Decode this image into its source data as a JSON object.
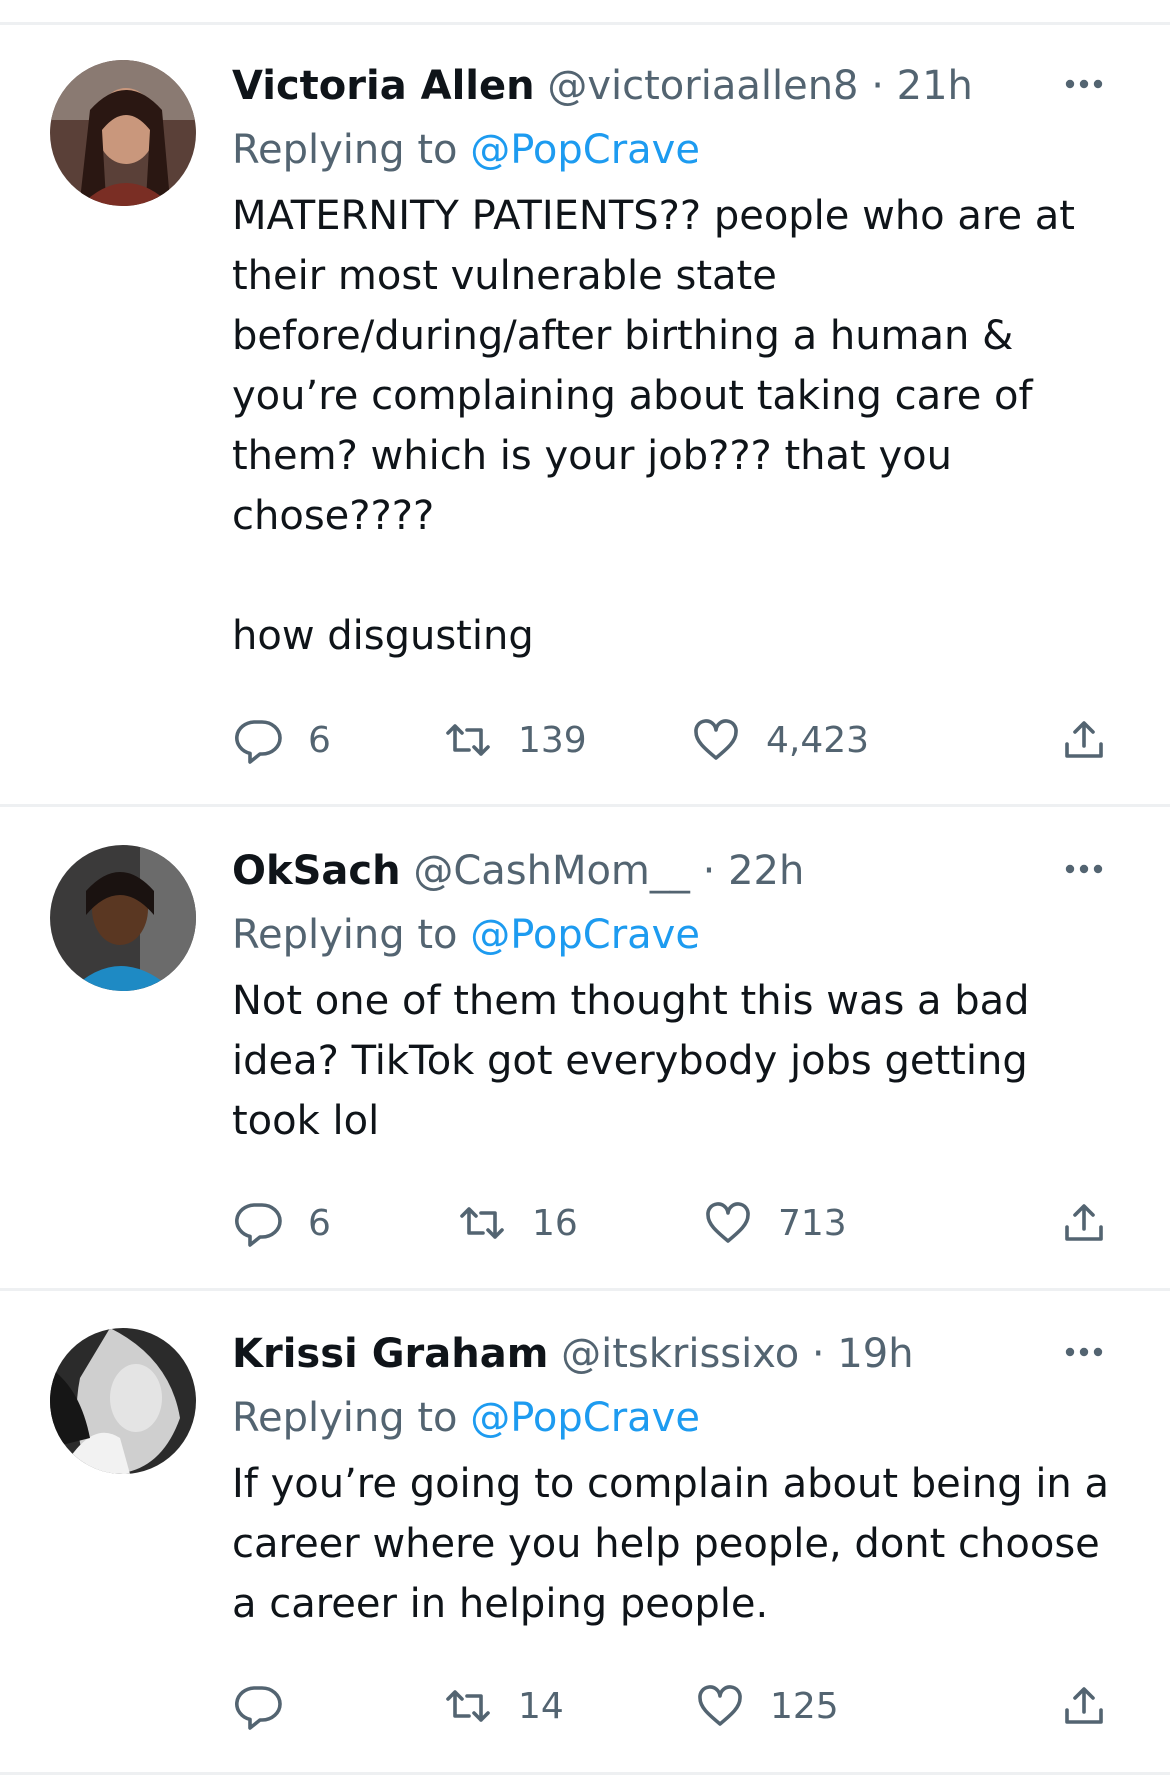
{
  "tweets": [
    {
      "display_name": "Victoria Allen",
      "handle": "@victoriaallen8",
      "sep": " · ",
      "time": "21h",
      "replying_prefix": "Replying to ",
      "replying_to": "@PopCrave",
      "text": "MATERNITY PATIENTS?? people who are at\ntheir most vulnerable state\nbefore/during/after birthing a human &\nyou’re complaining about taking care of\nthem? which is your job??? that you\nchose????\n\nhow disgusting",
      "replies": "6",
      "retweets": "139",
      "likes": "4,423"
    },
    {
      "display_name": "OkSach",
      "handle": "@CashMom__",
      "sep": " · ",
      "time": "22h",
      "replying_prefix": "Replying to ",
      "replying_to": "@PopCrave",
      "text": "Not one of them thought this was a bad\nidea? TikTok got everybody jobs getting\ntook lol",
      "replies": "6",
      "retweets": "16",
      "likes": "713"
    },
    {
      "display_name": "Krissi Graham",
      "handle": "@itskrissixo",
      "sep": " · ",
      "time": "19h",
      "replying_prefix": "Replying to ",
      "replying_to": "@PopCrave",
      "text": "If you’re going to complain about being in a\ncareer where you help people, dont choose\na career in helping people.",
      "replies": "",
      "retweets": "14",
      "likes": "125"
    }
  ],
  "colors": {
    "text": "#0f1419",
    "secondary": "#536471",
    "link": "#1d9bf0",
    "divider": "#eef0f2"
  },
  "icons": [
    "more-icon",
    "reply-icon",
    "retweet-icon",
    "like-icon",
    "share-icon"
  ]
}
